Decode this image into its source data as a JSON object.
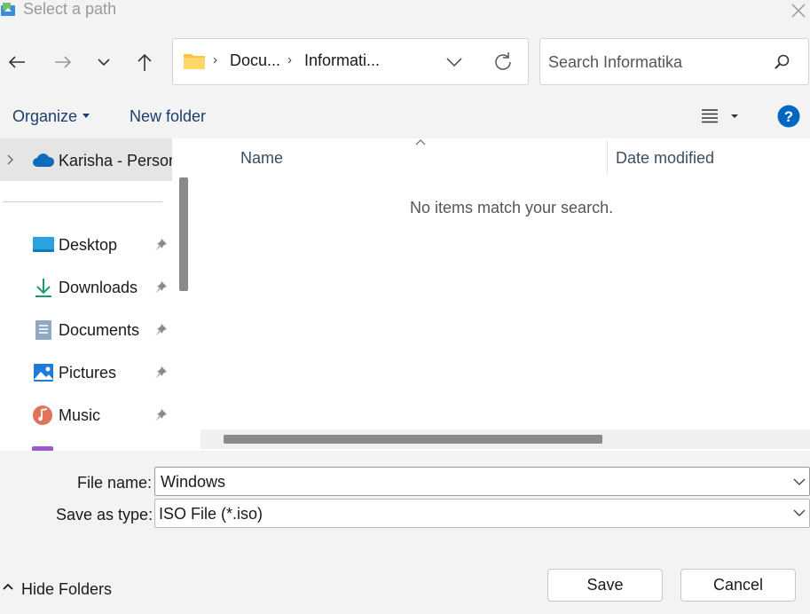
{
  "window": {
    "title": "Select a path"
  },
  "address_bar": {
    "breadcrumbs": [
      "Docu...",
      "Informati..."
    ],
    "separator": "›"
  },
  "search": {
    "placeholder": "Search Informatika"
  },
  "toolbar": {
    "organize_label": "Organize",
    "new_folder_label": "New folder",
    "help_label": "?"
  },
  "nav_pane": {
    "root_item": "Karisha - Personal",
    "items": [
      {
        "label": "Desktop",
        "icon": "desktop-icon",
        "pinned": true
      },
      {
        "label": "Downloads",
        "icon": "download-icon",
        "pinned": true
      },
      {
        "label": "Documents",
        "icon": "documents-icon",
        "pinned": true
      },
      {
        "label": "Pictures",
        "icon": "pictures-icon",
        "pinned": true
      },
      {
        "label": "Music",
        "icon": "music-icon",
        "pinned": true
      }
    ]
  },
  "file_list": {
    "columns": [
      "Name",
      "Date modified"
    ],
    "empty_message": "No items match your search."
  },
  "form": {
    "file_name_label": "File name:",
    "file_name_value": "Windows",
    "type_label": "Save as type:",
    "type_value": "ISO File (*.iso)"
  },
  "footer": {
    "hide_folders_label": "Hide Folders",
    "save_label": "Save",
    "cancel_label": "Cancel"
  },
  "colors": {
    "accent": "#0067c0",
    "link_text": "#1a3e6e",
    "selection": "#e5e5e5"
  }
}
